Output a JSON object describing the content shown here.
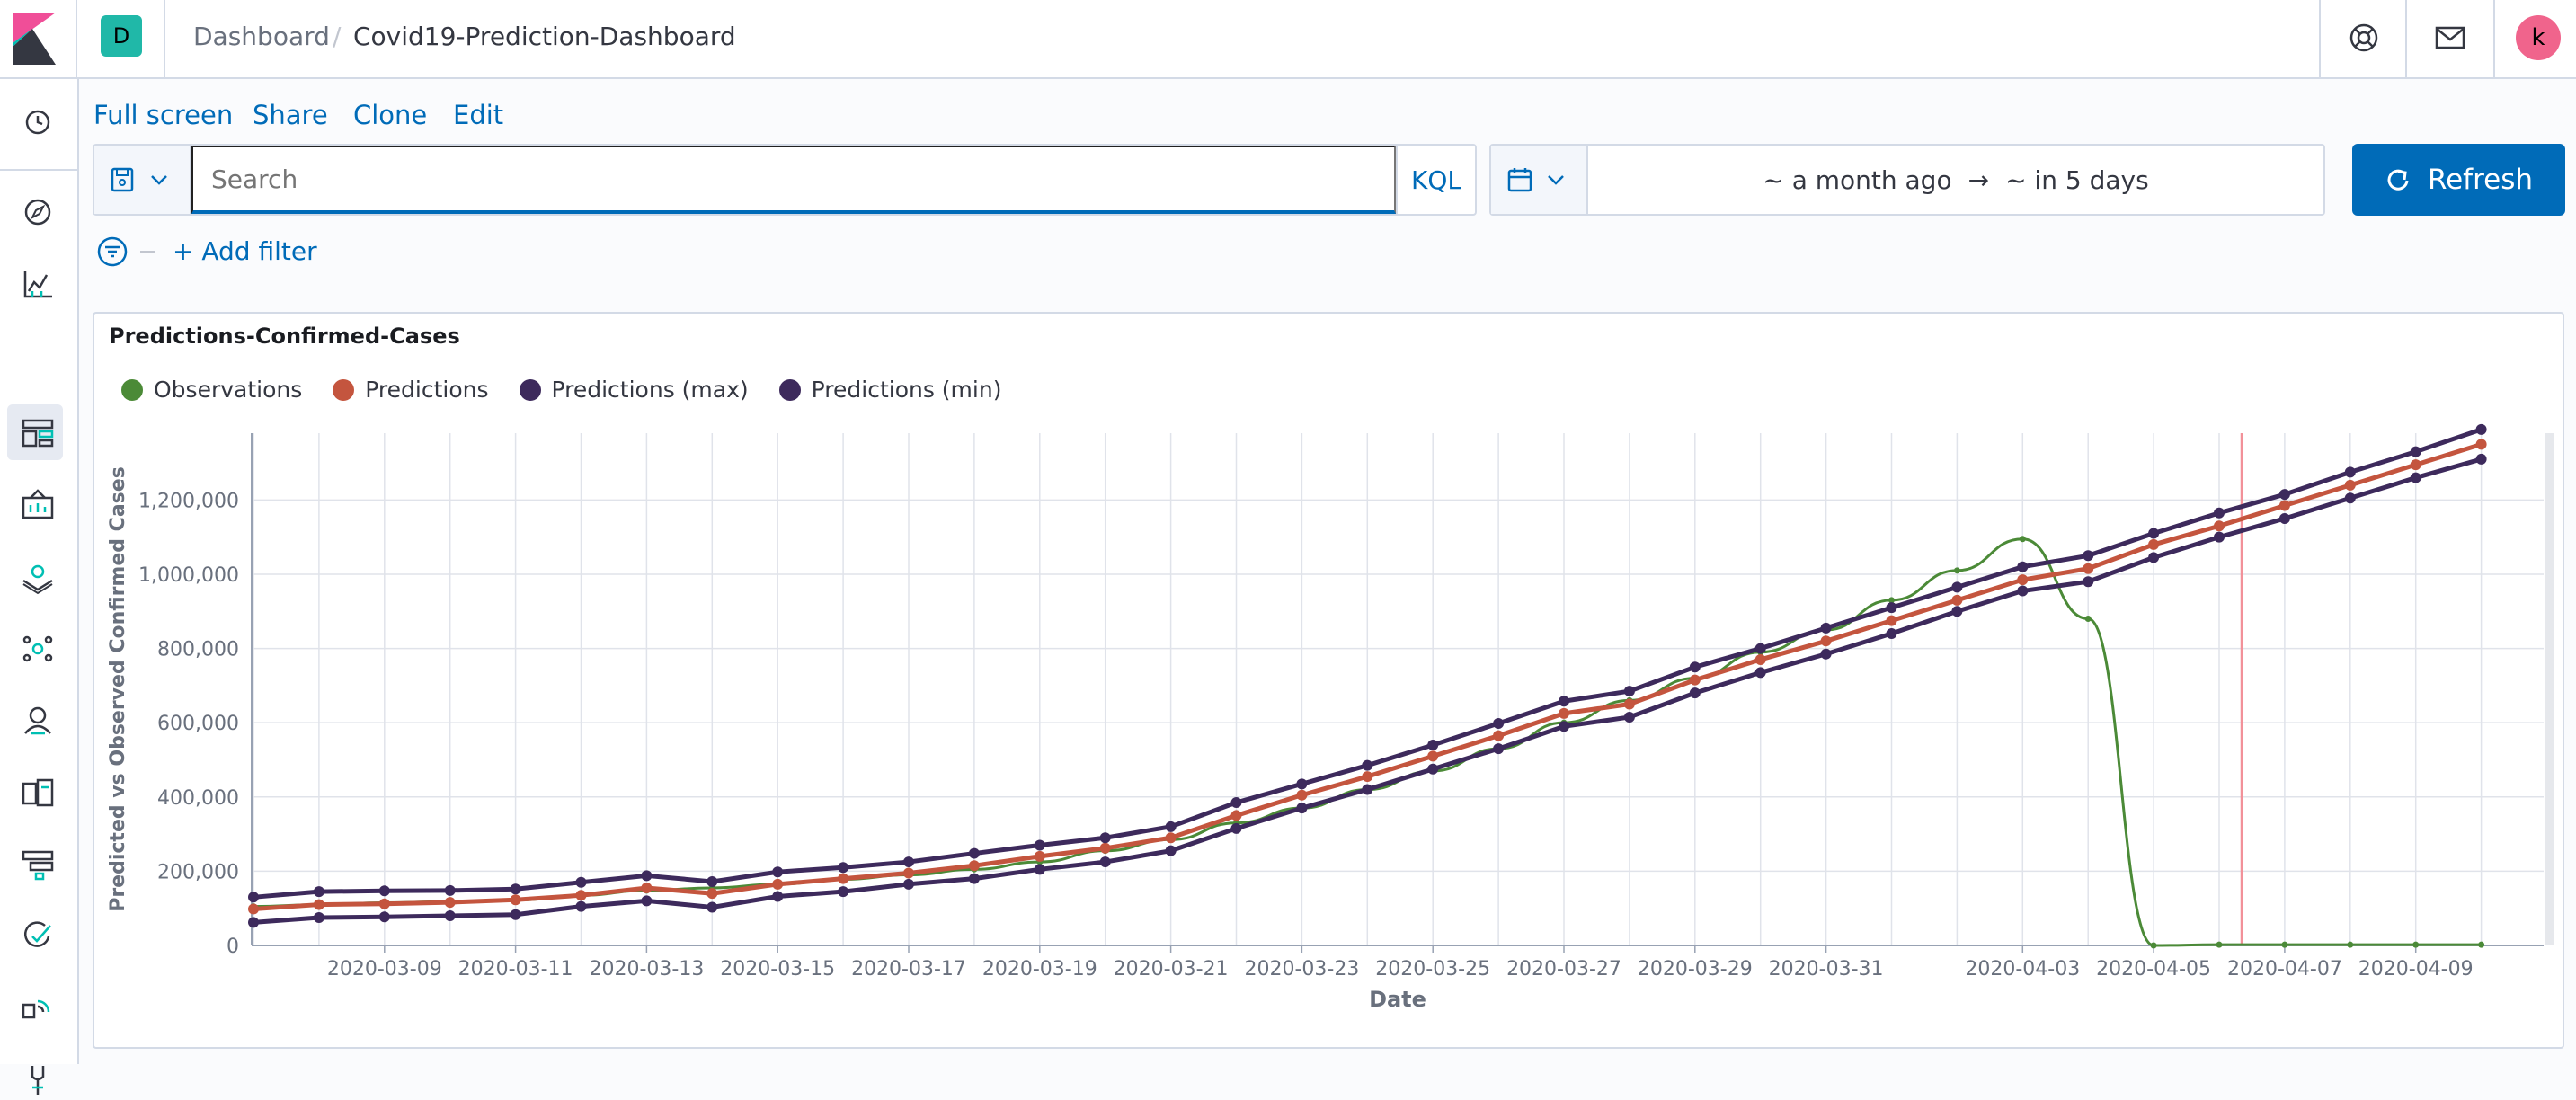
{
  "header": {
    "space_initial": "D",
    "breadcrumb_root": "Dashboard",
    "breadcrumb_sep": "/",
    "breadcrumb_current": "Covid19-Prediction-Dashboard",
    "user_initial": "k"
  },
  "top_nav": {
    "full_screen": "Full screen",
    "share": "Share",
    "clone": "Clone",
    "edit": "Edit"
  },
  "query": {
    "placeholder": "Search",
    "language": "KQL"
  },
  "time": {
    "start": "~ a month ago",
    "arrow": "→",
    "end": "~ in 5 days",
    "refresh_label": "Refresh"
  },
  "filters": {
    "add_filter": "+ Add filter"
  },
  "sidebar": {
    "items": [
      "clock-icon",
      "compass-icon",
      "visualize-icon",
      "dashboard-icon",
      "canvas-icon",
      "maps-icon",
      "ml-icon",
      "metrics-icon",
      "logs-icon",
      "apm-icon",
      "uptime-icon",
      "siem-icon",
      "monitoring-icon"
    ]
  },
  "panel": {
    "title": "Predictions-Confirmed-Cases"
  },
  "colors": {
    "observations": "#4b8a37",
    "predictions": "#c4553e",
    "predictions_max": "#3d2a5c",
    "predictions_min": "#3d2a5c",
    "accent": "#006bb8"
  },
  "chart_data": {
    "type": "line",
    "xlabel": "Date",
    "ylabel": "Predicted vs Observed Confirmed Cases",
    "ylim": [
      0,
      1380000
    ],
    "yticks": [
      0,
      200000,
      400000,
      600000,
      800000,
      1000000,
      1200000
    ],
    "ytick_labels": [
      "0",
      "200,000",
      "400,000",
      "600,000",
      "800,000",
      "1,000,000",
      "1,200,000"
    ],
    "xtick_labels": [
      "2020-03-09",
      "2020-03-11",
      "2020-03-13",
      "2020-03-15",
      "2020-03-17",
      "2020-03-19",
      "2020-03-21",
      "2020-03-23",
      "2020-03-25",
      "2020-03-27",
      "2020-03-29",
      "2020-03-31",
      "2020-04-03",
      "2020-04-05",
      "2020-04-07",
      "2020-04-09"
    ],
    "grid": true,
    "legend_position": "top-left",
    "current_time_marker": "2020-04-06",
    "series": [
      {
        "name": "Observations",
        "x": [
          "2020-03-07",
          "2020-03-08",
          "2020-03-09",
          "2020-03-10",
          "2020-03-11",
          "2020-03-12",
          "2020-03-13",
          "2020-03-14",
          "2020-03-15",
          "2020-03-16",
          "2020-03-17",
          "2020-03-18",
          "2020-03-19",
          "2020-03-20",
          "2020-03-21",
          "2020-03-22",
          "2020-03-23",
          "2020-03-24",
          "2020-03-25",
          "2020-03-26",
          "2020-03-27",
          "2020-03-28",
          "2020-03-29",
          "2020-03-30",
          "2020-03-31",
          "2020-04-01",
          "2020-04-02",
          "2020-04-03",
          "2020-04-04",
          "2020-04-05",
          "2020-04-06",
          "2020-04-07",
          "2020-04-08",
          "2020-04-09",
          "2020-04-10"
        ],
        "values": [
          105000,
          110000,
          115000,
          118000,
          122000,
          135000,
          148000,
          155000,
          165000,
          178000,
          190000,
          205000,
          225000,
          255000,
          285000,
          330000,
          370000,
          420000,
          470000,
          530000,
          600000,
          660000,
          720000,
          790000,
          850000,
          930000,
          1010000,
          1095000,
          880000,
          0,
          2000,
          2000,
          2000,
          2000,
          2000
        ]
      },
      {
        "name": "Predictions",
        "x": [
          "2020-03-07",
          "2020-03-08",
          "2020-03-09",
          "2020-03-10",
          "2020-03-11",
          "2020-03-12",
          "2020-03-13",
          "2020-03-14",
          "2020-03-15",
          "2020-03-16",
          "2020-03-17",
          "2020-03-18",
          "2020-03-19",
          "2020-03-20",
          "2020-03-21",
          "2020-03-22",
          "2020-03-23",
          "2020-03-24",
          "2020-03-25",
          "2020-03-26",
          "2020-03-27",
          "2020-03-28",
          "2020-03-29",
          "2020-03-30",
          "2020-03-31",
          "2020-04-01",
          "2020-04-02",
          "2020-04-03",
          "2020-04-04",
          "2020-04-05",
          "2020-04-06",
          "2020-04-07",
          "2020-04-08",
          "2020-04-09",
          "2020-04-10"
        ],
        "values": [
          98000,
          110000,
          112000,
          116000,
          123000,
          135000,
          155000,
          140000,
          165000,
          180000,
          195000,
          215000,
          240000,
          262000,
          290000,
          350000,
          405000,
          455000,
          510000,
          565000,
          625000,
          650000,
          715000,
          770000,
          820000,
          875000,
          930000,
          985000,
          1015000,
          1080000,
          1130000,
          1185000,
          1240000,
          1295000,
          1350000
        ]
      },
      {
        "name": "Predictions (max)",
        "x": [
          "2020-03-07",
          "2020-03-08",
          "2020-03-09",
          "2020-03-10",
          "2020-03-11",
          "2020-03-12",
          "2020-03-13",
          "2020-03-14",
          "2020-03-15",
          "2020-03-16",
          "2020-03-17",
          "2020-03-18",
          "2020-03-19",
          "2020-03-20",
          "2020-03-21",
          "2020-03-22",
          "2020-03-23",
          "2020-03-24",
          "2020-03-25",
          "2020-03-26",
          "2020-03-27",
          "2020-03-28",
          "2020-03-29",
          "2020-03-30",
          "2020-03-31",
          "2020-04-01",
          "2020-04-02",
          "2020-04-03",
          "2020-04-04",
          "2020-04-05",
          "2020-04-06",
          "2020-04-07",
          "2020-04-08",
          "2020-04-09",
          "2020-04-10"
        ],
        "values": [
          130000,
          145000,
          147000,
          148000,
          152000,
          170000,
          188000,
          172000,
          198000,
          210000,
          225000,
          248000,
          270000,
          290000,
          320000,
          385000,
          435000,
          485000,
          540000,
          598000,
          658000,
          685000,
          750000,
          800000,
          855000,
          910000,
          965000,
          1020000,
          1050000,
          1110000,
          1165000,
          1215000,
          1275000,
          1330000,
          1390000
        ]
      },
      {
        "name": "Predictions (min)",
        "x": [
          "2020-03-07",
          "2020-03-08",
          "2020-03-09",
          "2020-03-10",
          "2020-03-11",
          "2020-03-12",
          "2020-03-13",
          "2020-03-14",
          "2020-03-15",
          "2020-03-16",
          "2020-03-17",
          "2020-03-18",
          "2020-03-19",
          "2020-03-20",
          "2020-03-21",
          "2020-03-22",
          "2020-03-23",
          "2020-03-24",
          "2020-03-25",
          "2020-03-26",
          "2020-03-27",
          "2020-03-28",
          "2020-03-29",
          "2020-03-30",
          "2020-03-31",
          "2020-04-01",
          "2020-04-02",
          "2020-04-03",
          "2020-04-04",
          "2020-04-05",
          "2020-04-06",
          "2020-04-07",
          "2020-04-08",
          "2020-04-09",
          "2020-04-10"
        ],
        "values": [
          62000,
          75000,
          77000,
          80000,
          83000,
          105000,
          120000,
          103000,
          132000,
          145000,
          165000,
          180000,
          205000,
          225000,
          255000,
          315000,
          370000,
          420000,
          475000,
          530000,
          590000,
          615000,
          680000,
          735000,
          785000,
          840000,
          900000,
          955000,
          980000,
          1045000,
          1100000,
          1150000,
          1205000,
          1260000,
          1310000
        ]
      }
    ]
  }
}
